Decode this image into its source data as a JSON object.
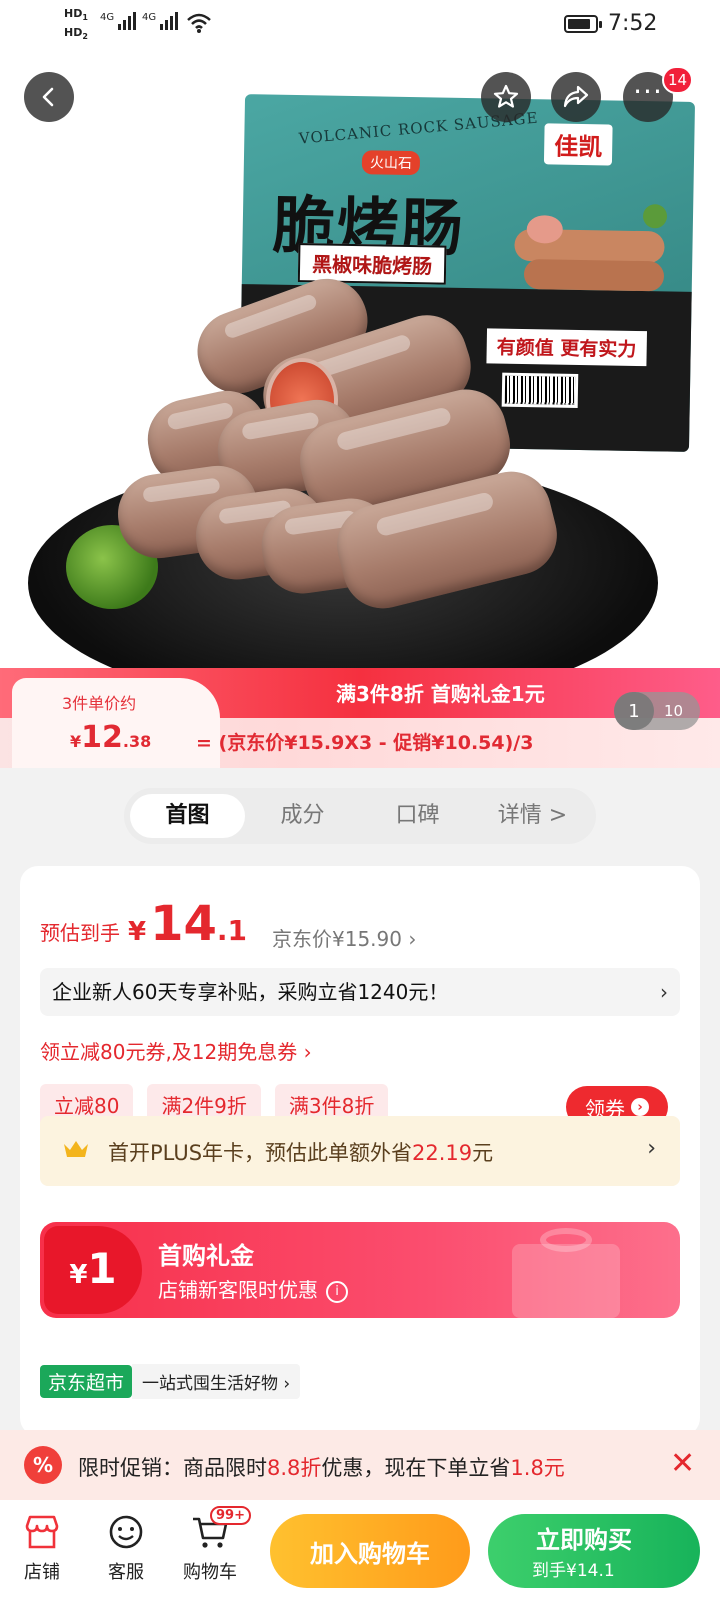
{
  "status_bar": {
    "hd1": "HD",
    "hd1_sub": "1",
    "hd2": "HD",
    "hd2_sub": "2",
    "net1": "4G",
    "net2": "4G",
    "time": "7:52",
    "icons": [
      "signal-icon",
      "wifi-icon",
      "battery-icon"
    ]
  },
  "hero": {
    "package_english": "VOLCANIC ROCK SAUSAGE",
    "package_badge": "火山石",
    "product_name": "脆烤肠",
    "flavor": "黑椒味脆烤肠",
    "brand": "佳凯",
    "slogan": "有颜值 更有实力",
    "more_badge": "14",
    "icons": [
      "back-icon",
      "star-icon",
      "share-icon",
      "more-icon"
    ]
  },
  "promo": {
    "per_label": "3件单价约",
    "price_symbol": "¥",
    "price_int": "12",
    "price_dec": ".38",
    "headline": "满3件8折 首购礼金1元",
    "formula": "= (京东价¥15.9X3 - 促销¥10.54)/3",
    "page_current": "1",
    "page_total": "10"
  },
  "tabs": [
    {
      "label": "首图",
      "active": true
    },
    {
      "label": "成分",
      "active": false
    },
    {
      "label": "口碑",
      "active": false
    },
    {
      "label": "详情 >",
      "active": false
    }
  ],
  "price": {
    "est_label": "预估到手",
    "symbol": "¥",
    "int": "14",
    "dec": ".1",
    "jd_price": "京东价¥15.90 ›"
  },
  "subsidy": {
    "text": "企业新人60天专享补贴，采购立省1240元！",
    "chevron": "›"
  },
  "coupon_link": "领立减80元券,及12期免息券 ›",
  "tags": [
    "立减80",
    "满2件9折",
    "满3件8折"
  ],
  "get_coupon": {
    "label": "领券",
    "icon": "chevron-right-icon"
  },
  "plus": {
    "prefix": "首开PLUS年卡，预估此单额外省",
    "amount": "22.19",
    "suffix": "元",
    "chevron": "›"
  },
  "gift": {
    "symbol": "¥",
    "amount": "1",
    "title": "首购礼金",
    "desc": "店铺新客限时优惠"
  },
  "market": {
    "badge": "京东超市",
    "slogan": "一站式囤生活好物 ›"
  },
  "limit_promo": {
    "prefix": "限时促销：商品限时",
    "discount": "8.8折",
    "middle": "优惠，现在下单立省",
    "saving": "1.8元"
  },
  "bottom_nav": {
    "store": "店铺",
    "service": "客服",
    "cart": "购物车",
    "cart_badge": "99+",
    "add_cart": "加入购物车",
    "buy_now": "立即购买",
    "buy_now_sub": "到手¥14.1"
  },
  "colors": {
    "accent_red": "#e4282e",
    "promo_strip": "#f5303f",
    "add_cart": "#ff9b1a",
    "buy_now": "#17b35a",
    "plus_bg": "#fcf3df",
    "market_green": "#1ba85a"
  }
}
